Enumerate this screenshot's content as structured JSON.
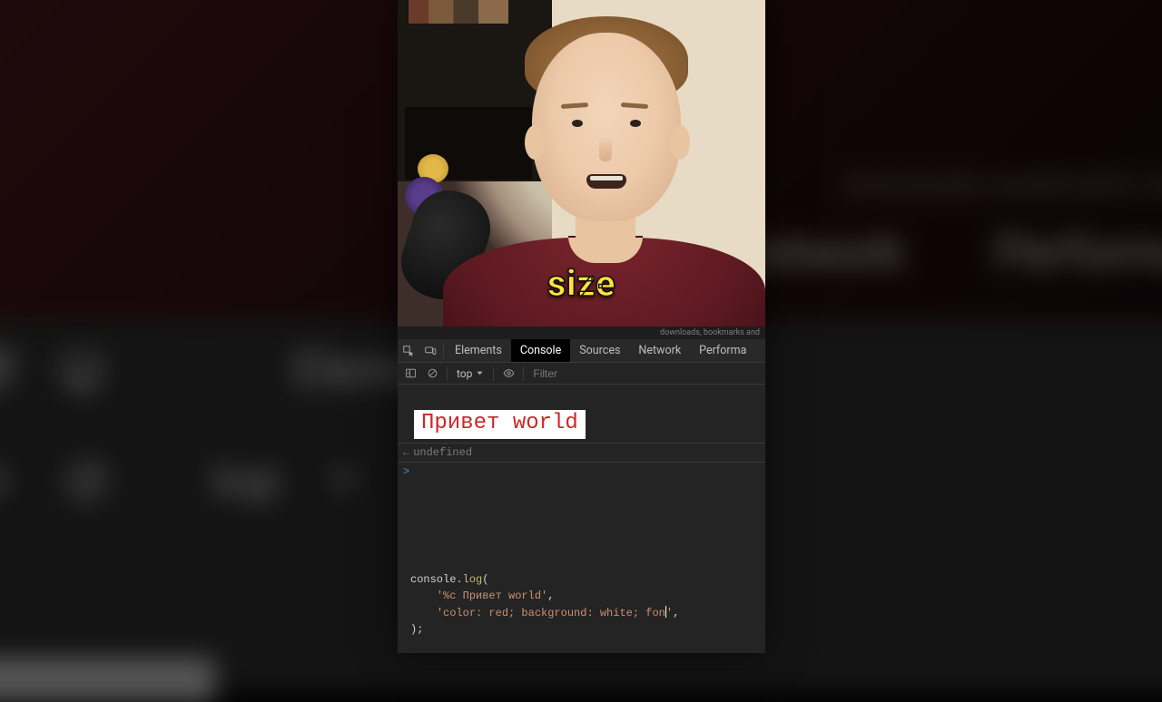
{
  "caption": "size",
  "bg": {
    "tabs": {
      "elements": "Elements",
      "network": "Network",
      "performance": "Performa"
    },
    "toolbar": {
      "context": "top"
    },
    "hint": "downloads, bookmarks and"
  },
  "devtools": {
    "hint": "downloads, bookmarks and",
    "tabs": {
      "elements": "Elements",
      "console": "Console",
      "sources": "Sources",
      "network": "Network",
      "performance": "Performa"
    },
    "toolbar": {
      "context": "top",
      "filter_placeholder": "Filter"
    },
    "output": {
      "styled_text": "Привет world",
      "return_value": "undefined",
      "prompt": ">"
    },
    "editor": {
      "l1_obj": "console",
      "l1_dot": ".",
      "l1_meth": "log",
      "l1_open": "(",
      "l2_str": "'%c Привет world'",
      "l2_comma": ",",
      "l3_str_pre": "'color: red; background: white; fon",
      "l3_str_post": "'",
      "l3_comma": ",",
      "l4_close": ");"
    }
  }
}
